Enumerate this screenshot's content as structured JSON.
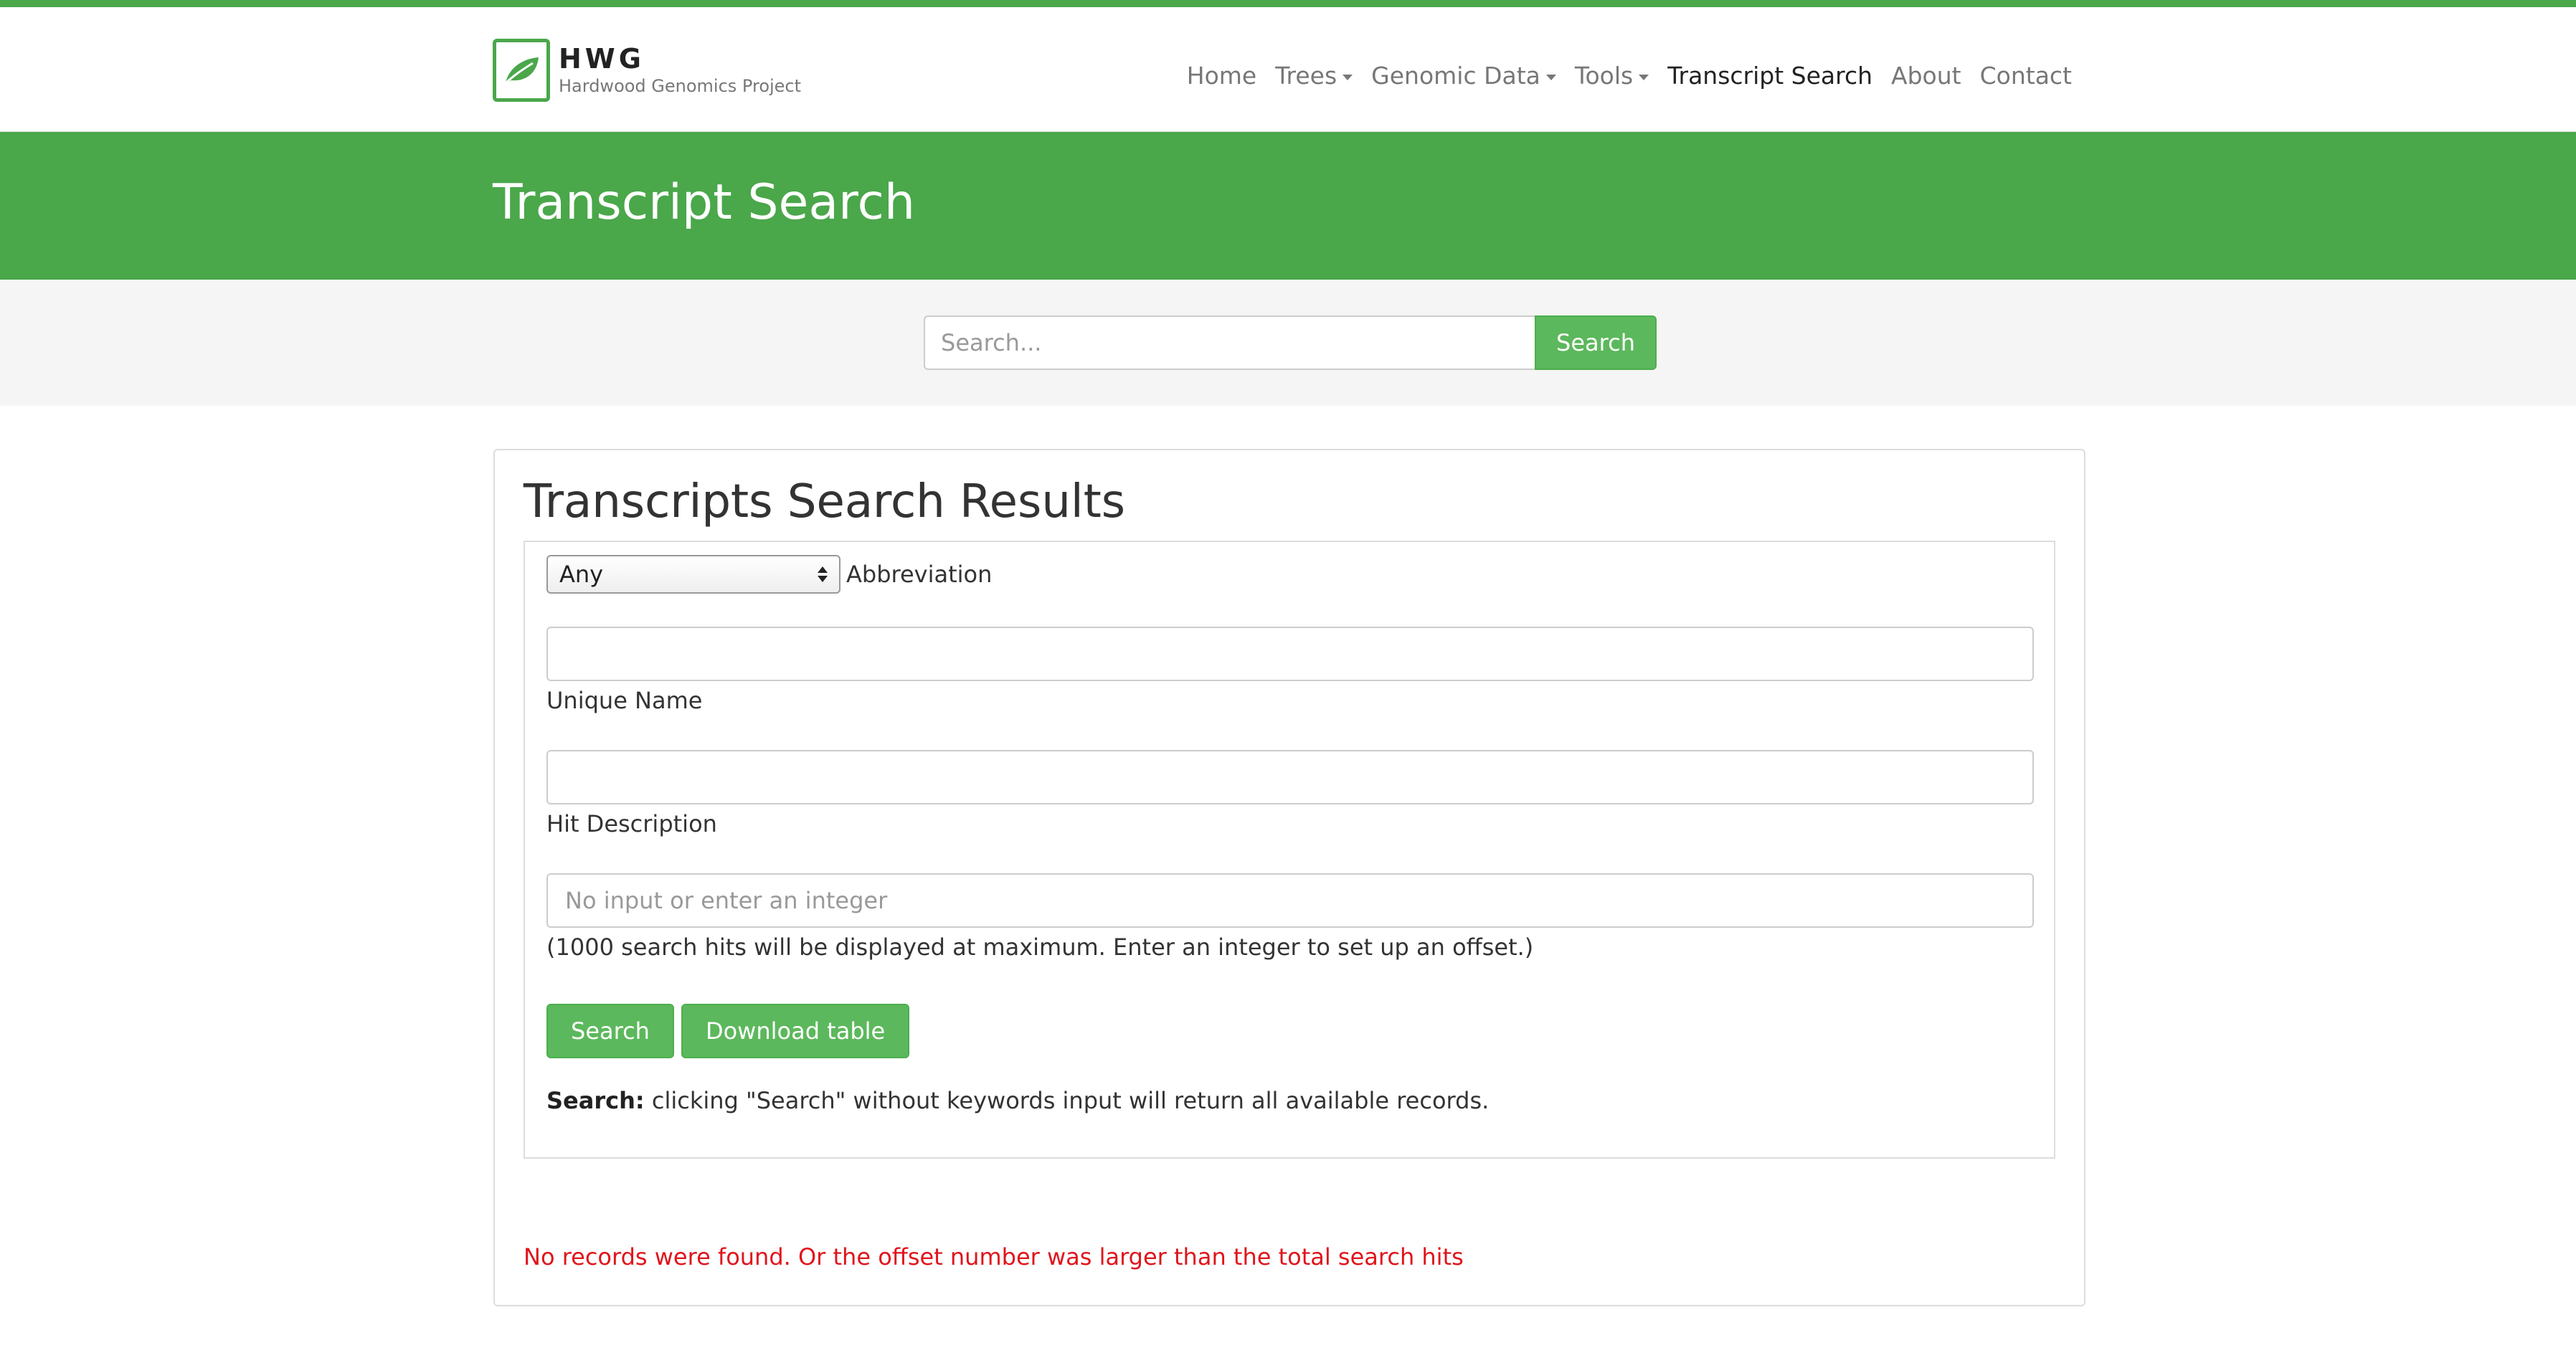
{
  "colors": {
    "brand_green": "#4aa74a",
    "button_green": "#5cb85c",
    "error_red": "#e0141b"
  },
  "brand": {
    "icon": "leaf-icon",
    "title": "HWG",
    "subtitle": "Hardwood Genomics Project"
  },
  "nav": {
    "items": [
      {
        "label": "Home",
        "dropdown": false
      },
      {
        "label": "Trees",
        "dropdown": true
      },
      {
        "label": "Genomic Data",
        "dropdown": true
      },
      {
        "label": "Tools",
        "dropdown": true
      },
      {
        "label": "Transcript Search",
        "dropdown": false,
        "active": true
      },
      {
        "label": "About",
        "dropdown": false
      },
      {
        "label": "Contact",
        "dropdown": false
      }
    ]
  },
  "hero": {
    "title": "Transcript Search"
  },
  "site_search": {
    "placeholder": "Search...",
    "button_label": "Search"
  },
  "form": {
    "title": "Transcripts Search",
    "abbreviation": {
      "selected": "Any",
      "label": "Abbreviation"
    },
    "unique_name": {
      "value": "",
      "label": "Unique Name"
    },
    "hit_description": {
      "value": "",
      "label": "Hit Description"
    },
    "offset": {
      "value": "",
      "placeholder": "No input or enter an integer",
      "help": "(1000 search hits will be displayed at maximum. Enter an integer to set up an offset.)"
    },
    "search_button": "Search",
    "download_button": "Download table",
    "note_bold": "Search:",
    "note_text": " clicking \"Search\" without keywords input will return all available records."
  },
  "results": {
    "title": "Transcripts Search Results",
    "message": "No records were found. Or the offset number was larger than the total search hits"
  }
}
